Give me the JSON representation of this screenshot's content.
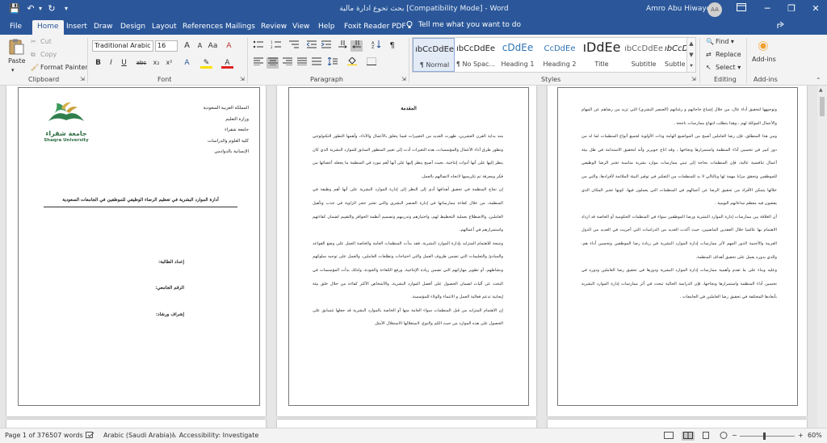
{
  "window": {
    "title": "بحث تحوع ادارة مالية [Compatibility Mode] - Word",
    "user": "Amro Abu Hiwayej",
    "avatar_initials": "AA",
    "minimize": "─",
    "restore": "❐",
    "close": "✕"
  },
  "quick_access": {
    "autosave": "💾",
    "undo": "↶",
    "undo_arrow": "▾",
    "redo": "↻",
    "customize": "▾"
  },
  "tabs": [
    "File",
    "Home",
    "Insert",
    "Draw",
    "Design",
    "Layout",
    "References",
    "Mailings",
    "Review",
    "View",
    "Help",
    "Foxit Reader PDF"
  ],
  "tell_me": "Tell me what you want to do",
  "share_icon": "share-icon",
  "ribbon": {
    "clipboard": {
      "paste": "Paste",
      "cut": "Cut",
      "copy": "Copy",
      "format_painter": "Format Painter",
      "label": "Clipboard"
    },
    "font": {
      "family": "Traditional Arabic",
      "size": "16",
      "grow": "A",
      "shrink": "A",
      "case": "Aa",
      "clear": "A",
      "bold": "B",
      "italic": "I",
      "underline": "U",
      "strike": "abc",
      "sub": "x₂",
      "sup": "x²",
      "effects": "A",
      "highlight": "✎",
      "color": "A",
      "label": "Font"
    },
    "paragraph": {
      "label": "Paragraph",
      "show_marks": "¶"
    },
    "styles": {
      "label": "Styles",
      "items": [
        {
          "preview": "ıbCcDdEe",
          "name": "¶ Normal"
        },
        {
          "preview": "ıbCcDdEe",
          "name": "¶ No Spac..."
        },
        {
          "preview": "cDdEe",
          "name": "Heading 1"
        },
        {
          "preview": "CcDdEe",
          "name": "Heading 2"
        },
        {
          "preview": "ıDdEe",
          "name": "Title"
        },
        {
          "preview": "ıbCcDdEe",
          "name": "Subtitle"
        },
        {
          "preview": "ıbCcDdEe",
          "name": "Subtle Em..."
        }
      ]
    },
    "editing": {
      "find": "Find",
      "replace": "Replace",
      "select": "Select",
      "label": "Editing"
    },
    "addins": {
      "label": "Add-ins",
      "button": "Add-ins"
    }
  },
  "page1": {
    "org_lines": [
      "المملكة العربية السعودية",
      "وزارة التعليم",
      "جامعة شقراء",
      "كلية العلوم والدراسات",
      "الإنسانية بالدوادمي"
    ],
    "logo_arabic": "جامعة شقراء",
    "logo_english": "Shaqra University",
    "title": "أدارة الموارد البشرية في تعظيم الرضاء الوظيفي للموظفين في الجامعات السعودية",
    "fields": [
      "إعداد الطالبة:",
      "الرقم الجامعي:",
      "إشراف ورشاد:"
    ]
  },
  "page2": {
    "heading": "المقدمة",
    "paragraphs": [
      "منذ بداية القرن العشرين، ظهرت العديد من التغييرات فيما يتعلق بالأعمال والأداء، وأهمها التطور التكنولوجي وتطور طرق أداء الأعمال والمؤسسات، هذه التغيرات أدت إلى تغيير المنظور السابق للموارد البشرية الذي كان ينظر إليها على أنها أدوات إنتاجية، بحيث أصبح ينظر إليها على أنها أهم مورد في المنظمة ما يجعله أعضائها من فكر ومعرفة تم تكريسها لاتجاه لاتصالهم بالعمل.",
      "إن نجاح المنظمة في تحقيق أهدافها أدى إلى النظر إلى إدارة الموارد البشرية على أنها أهم وظيفة في المنظمة، من خلال كفاءة ممارساتها في إدارة العنصر البشري والتي تعتبر حجر الزاوية في جذب وتأهيل العاملين، والاضطلاع بعملية التخطيط لهم، واختيارهم وتدريبهم وتصميم أنظمة الحوافز والتقييم لضمان كفاءتهم واستمرارهم في أعمالهم.",
      "ونتيجة للاهتمام المتزايد بإدارة الموارد البشرية، فقد بدأت المنظمات العامة والخاصة العمل على وضع القواعد والمبادئ والتعليمات التي تضمن ظروف العمل والتي احتياجات وتطلعات العاملين، والعمل على توجيه سلوكهم ونشاطهم، أو تطوير مهاراتهم التي تضمن زيادة الإنتاجية، ورفع الكفاءة والجودة، ولذلك بدأت المؤسسات في البحث عن آليات لضمان الحصول على أفضل الموارد البشرية، والأشخاص الأكثر كفاءة من خلال خلق بيئة إيجابية تدعم فعالية العمل و الانتماء والولاء للمؤسسة.",
      "إن الاهتمام المتزايد من قبل المنظمات سواء العامة منها أو الخاصة بالموارد البشرية قد جعلها تتسابق على الحصول على هذه الموارد من حيث الكم والنوع، لاستغلالها الاستغلال الأمثل"
    ]
  },
  "page3": {
    "paragraphs": [
      "وتوجيهها لتحقيق أداء عال، من خلال إشباع حاجاتهم و رغباتهم (العنصر البشري) التي تزيد من رضاهم عن المهام والأعمال الموكلة لهم ، وهذا يتطلب انتهاج ممارسات ناجحة .",
      "ومن هذا المنطلق، فإن رضا العاملين أصبح من المواضيع الهامة وذات الأولوية لجميع أنواع المنظمات لما له من دور كبير في تحسين أداء المنظمة واستمرارها ونجاحها ، وقد اتاح جويرير وأنه لتحقيق الاستدامة في ظل بيئة أعمال تنافسية عالية، فإن المنظمات بحاجة إلى تبني ممارسات موارد بشرية مناسبة تعتبر الرضا الوظيفي للموظفين وتحقق مزايا مهمة لها وبالتالي لا بد للمنظمات من التفكير في توفير البيئة الملائمة لأفرادها، والتي من خلالها يتمكن الأفراد من تحقيق الرضا عن أعمالهم في المنظمات التي يعملون فيها، كونها تعتبر المكان الذي يقضون فيه معظم ساعاتهم اليومية .",
      "أن العلاقة بين ممارسات إدارة الموارد البشرية ورضا الموظفين سواء في المنظمات الحكومية أو الخاصة قد ازداد الاهتمام بها عالميا خلال العقدين الماضيين، حيث أكدت العديد من الدراسات التي أجريت في العديد من الدول العربية والأجنبية الدور المهم لأثر ممارسات إدارة الموارد البشرية في زيادة رضا الموظفين وتحسين أداء هم، والذي بدوره يعمل على تحقيق أهداف المنظمة.",
      "وعليه وبناء على ما تقدم وأهمية ممارسات إدارة الموارد البشرية ودورها في تحقيق رضا العاملين ودوره في تحسين أداء المنظمة واستمرارها ونجاحها، فإن الدراسة الحالية تبحث في أثر ممارسات إدارة الموارد البشرية بأبعادها المختلفة في تحقيق رضا العاملين في الجامعات ."
    ]
  },
  "status": {
    "page": "Page 1 of 37",
    "words": "6507 words",
    "proofing_icon": "proofing-icon",
    "language": "Arabic (Saudi Arabia)",
    "accessibility": "Accessibility: Investigate",
    "zoom": "60%",
    "zoom_minus": "−",
    "zoom_plus": "+"
  }
}
